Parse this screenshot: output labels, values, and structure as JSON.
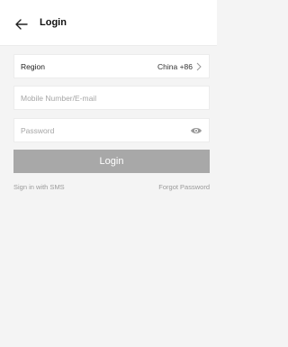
{
  "header": {
    "title": "Login",
    "back_icon": "back-arrow-icon"
  },
  "form": {
    "region": {
      "label": "Region",
      "value": "China +86"
    },
    "mobile": {
      "placeholder": "Mobile Number/E-mail"
    },
    "password": {
      "placeholder": "Password"
    }
  },
  "actions": {
    "login_label": "Login",
    "sms_link": "Sign in with SMS",
    "forgot_link": "Forgot Password"
  }
}
